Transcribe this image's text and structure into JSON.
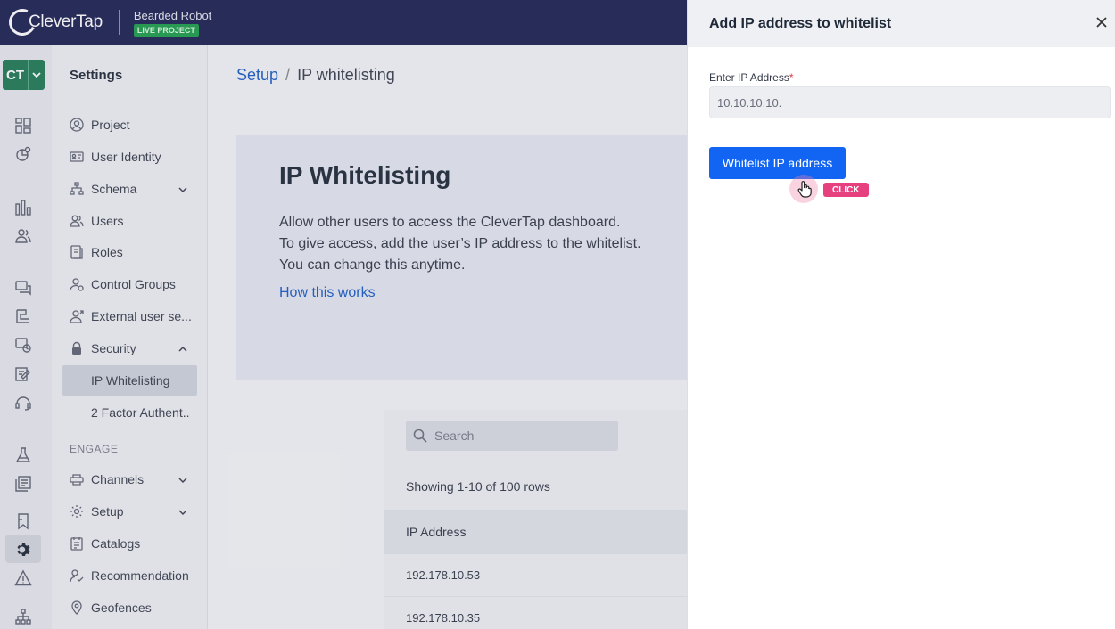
{
  "topbar": {
    "logo_text": "CleverTap",
    "project_name": "Bearded Robot",
    "project_badge": "LIVE PROJECT"
  },
  "rail": {
    "account_initials": "CT",
    "icons": [
      "dashboard-icon",
      "analytics-icon",
      "bar-chart-icon",
      "segments-icon",
      "messages-icon",
      "journeys-icon",
      "campaigns-icon",
      "catalog-icon",
      "support-icon",
      "experiments-icon",
      "content-icon",
      "bookmark-icon",
      "settings-icon",
      "alert-icon",
      "hierarchy-icon"
    ]
  },
  "sidebar": {
    "title": "Settings",
    "items": [
      {
        "label": "Project",
        "icon": "project-icon"
      },
      {
        "label": "User Identity",
        "icon": "id-card-icon"
      },
      {
        "label": "Schema",
        "icon": "schema-icon"
      },
      {
        "label": "Users",
        "icon": "users-icon"
      },
      {
        "label": "Roles",
        "icon": "roles-icon"
      },
      {
        "label": "Control Groups",
        "icon": "control-groups-icon"
      },
      {
        "label": "External user se...",
        "icon": "external-user-icon"
      },
      {
        "label": "Security",
        "icon": "lock-icon"
      },
      {
        "label": "IP Whitelisting"
      },
      {
        "label": "2 Factor Authent.."
      }
    ],
    "section_engage": "ENGAGE",
    "engage_items": [
      {
        "label": "Channels",
        "icon": "channels-icon"
      },
      {
        "label": "Setup",
        "icon": "gear-icon"
      },
      {
        "label": "Catalogs",
        "icon": "catalog-icon"
      },
      {
        "label": "Recommendation",
        "icon": "recommendation-icon"
      },
      {
        "label": "Geofences",
        "icon": "location-pin-icon"
      }
    ]
  },
  "breadcrumb": {
    "parent": "Setup",
    "separator": "/",
    "current": "IP whitelisting"
  },
  "hero": {
    "title": "IP Whitelisting",
    "line1": "Allow other users to access the CleverTap dashboard.",
    "line2": "To give access, add the user’s IP address to the whitelist.",
    "line3": "You can change this anytime.",
    "link": "How this works"
  },
  "table": {
    "search_placeholder": "Search",
    "rows_info": "Showing 1-10 of 100 rows",
    "column_header": "IP Address",
    "rows": [
      "192.178.10.53",
      "192.178.10.35"
    ]
  },
  "drawer": {
    "title": "Add IP address to whitelist",
    "field_label": "Enter IP Address",
    "required_marker": "*",
    "ip_value": "10.10.10.10.",
    "submit_label": "Whitelist IP address",
    "click_tag": "CLICK"
  },
  "colors": {
    "topbar": "#1d2152",
    "accent_blue": "#1265f3",
    "link_blue": "#1a5cc5",
    "live_badge": "#1c9e4a",
    "click_tag": "#e6407f"
  }
}
